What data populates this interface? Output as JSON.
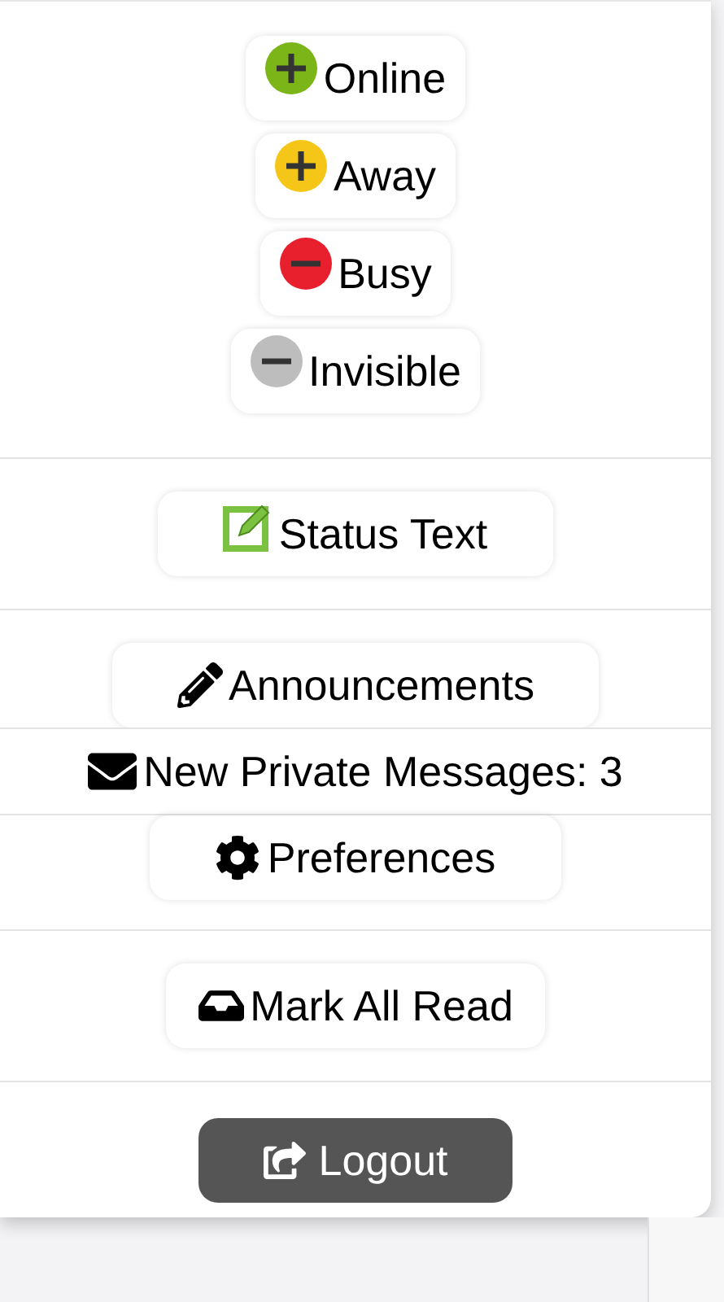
{
  "statuses": [
    {
      "label": "Online",
      "kind": "plus",
      "color": "#7cb518"
    },
    {
      "label": "Away",
      "kind": "plus",
      "color": "#f5c518"
    },
    {
      "label": "Busy",
      "kind": "minus",
      "color": "#e8202e"
    },
    {
      "label": "Invisible",
      "kind": "minus",
      "color": "#bdbdbd"
    }
  ],
  "status_text": {
    "label": "Status Text"
  },
  "menu": [
    {
      "label": "Announcements",
      "kind": "button"
    },
    {
      "label": "New Private Messages: 3",
      "kind": "banner"
    },
    {
      "label": "Preferences",
      "kind": "button"
    }
  ],
  "mark_all_read": {
    "label": "Mark All Read"
  },
  "logout": {
    "label": "Logout"
  }
}
